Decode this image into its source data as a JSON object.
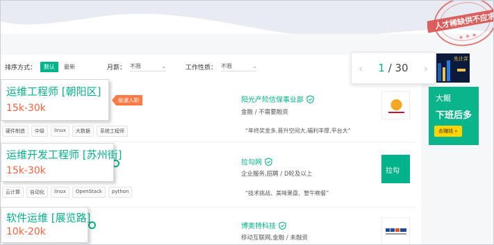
{
  "filters": {
    "sort_label": "排序方式：",
    "sort_default": "默认",
    "sort_latest": "最新",
    "salary_label": "月薪：",
    "salary_value": "不限",
    "nature_label": "工作性质：",
    "nature_value": "不限"
  },
  "pagination": {
    "current": "1",
    "separator": " / ",
    "total": "30"
  },
  "stamp_text": "人才稀缺供不应求",
  "jobs": [
    {
      "title": "运维工程师 [朝阳区]",
      "salary": "15k-30k",
      "badge": "极速入职",
      "company": "阳光产险信保事业部",
      "industry": "金融 / 不需要融资",
      "quote": "“年终奖金多,晋升空间大,福利丰厚,平台大”",
      "tags": [
        "硬件制造",
        "中级",
        "linux",
        "大数据",
        "系统工程师"
      ]
    },
    {
      "title": "运维开发工程师 [苏州街]",
      "salary": "15k-30k",
      "company": "拉勾网",
      "industry": "企业服务,招聘 / D轮及以上",
      "quote": "“技术挑战、美味果盘、管午晚餐”",
      "tags": [
        "云计算",
        "自动化",
        "linux",
        "OpenStack",
        "python"
      ],
      "logo_text": "拉勾"
    },
    {
      "title": "软件运维 [展览路]",
      "salary": "10k-20k",
      "company": "博奥特科技",
      "industry": "移动互联网,金融 / 未融资"
    }
  ],
  "ads": {
    "dark_text": "先计并",
    "green_brand": "大鲲",
    "green_sub": "下班后多",
    "green_button": "去赚钱 »"
  }
}
